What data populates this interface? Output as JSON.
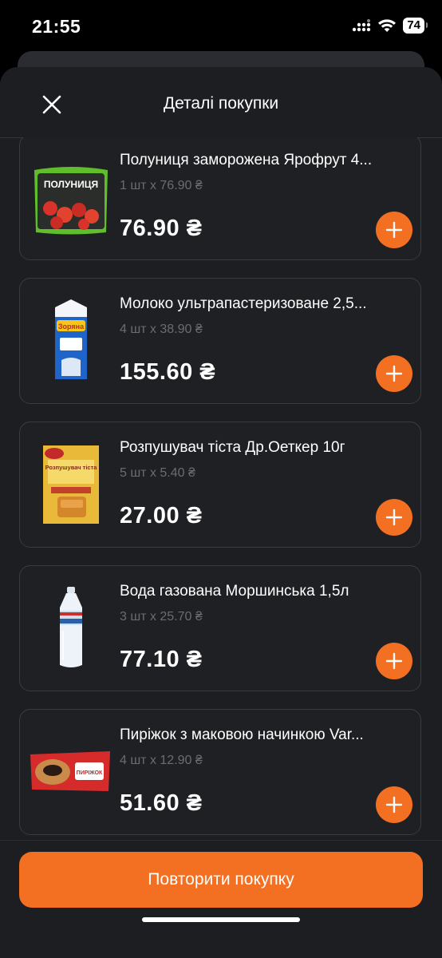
{
  "status": {
    "time": "21:55",
    "battery": "74"
  },
  "header": {
    "title": "Деталі покупки"
  },
  "items": [
    {
      "name": "Полуниця заморожена Ярофрут 4...",
      "qty": "1 шт x 76.90 ₴",
      "total": "76.90 ₴",
      "thumb_icon": "strawberry-bag-icon",
      "thumb_label": "ПОЛУНИЦЯ"
    },
    {
      "name": "Молоко ультрапастеризоване 2,5...",
      "qty": "4 шт x 38.90 ₴",
      "total": "155.60 ₴",
      "thumb_icon": "milk-carton-icon",
      "thumb_label": "Зоряна"
    },
    {
      "name": "Розпушувач тіста Др.Оеткер 10г",
      "qty": "5 шт x 5.40 ₴",
      "total": "27.00 ₴",
      "thumb_icon": "baking-powder-pack-icon",
      "thumb_label": "Розпушувач тіста"
    },
    {
      "name": "Вода газована Моршинська 1,5л",
      "qty": "3 шт x 25.70 ₴",
      "total": "77.10 ₴",
      "thumb_icon": "water-bottle-icon",
      "thumb_label": ""
    },
    {
      "name": "Пиріжок з маковою начинкою Var...",
      "qty": "4 шт x 12.90 ₴",
      "total": "51.60 ₴",
      "thumb_icon": "pastry-pack-icon",
      "thumb_label": "ПИРІЖОК"
    }
  ],
  "footer": {
    "repeat_label": "Повторити покупку"
  },
  "colors": {
    "accent": "#f36f21",
    "background": "#1d1e22",
    "card_border": "#3a3b40",
    "muted_text": "#6b6c72"
  }
}
